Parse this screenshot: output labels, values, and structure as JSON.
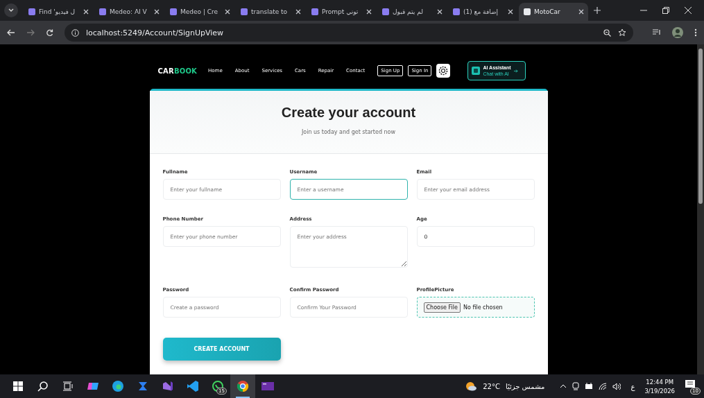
{
  "browser": {
    "tabs": [
      {
        "title": "Find 'ل فيديو",
        "selected": false
      },
      {
        "title": "Medeo: AI V",
        "selected": false
      },
      {
        "title": "Medeo | Cre",
        "selected": false
      },
      {
        "title": "translate to",
        "selected": false
      },
      {
        "title": "Prompt توني",
        "selected": false
      },
      {
        "title": "لم يتم قبول",
        "selected": false
      },
      {
        "title": "(1) إضافة مع",
        "selected": false
      },
      {
        "title": "MotoCar",
        "selected": true
      }
    ],
    "address": "localhost:5249/Account/SignUpView"
  },
  "nav": {
    "logo": [
      "CAR",
      "BOOK"
    ],
    "links": [
      "Home",
      "About",
      "Services",
      "Cars",
      "Repair",
      "Contact"
    ],
    "buttons": [
      "Sign Up",
      "Sign In"
    ],
    "assistant": {
      "title": "AI Assistant",
      "subtitle": "Chat with AI"
    }
  },
  "form": {
    "title": "Create your account",
    "subtitle": "Join us today and get started now",
    "fields": [
      {
        "label": "Fullname",
        "kind": "input",
        "placeholder": "Enter your fullname",
        "focused": false
      },
      {
        "label": "Username",
        "kind": "input",
        "placeholder": "Enter a username",
        "focused": true
      },
      {
        "label": "Email",
        "kind": "input",
        "placeholder": "Enter your email address",
        "focused": false
      },
      {
        "label": "Phone Number",
        "kind": "input",
        "placeholder": "Enter your phone number",
        "focused": false
      },
      {
        "label": "Address",
        "kind": "textarea",
        "placeholder": "Enter your address",
        "focused": false
      },
      {
        "label": "Age",
        "kind": "input",
        "value": "0",
        "focused": false
      },
      {
        "label": "Password",
        "kind": "input",
        "placeholder": "Create a password",
        "focused": false
      },
      {
        "label": "Confirm Password",
        "kind": "input",
        "placeholder": "Confirm Your Password",
        "focused": false
      },
      {
        "label": "ProfilePicture",
        "kind": "file",
        "button": "Choose File",
        "status": "No file chosen",
        "focused": false
      }
    ],
    "submit": "CREATE ACCOUNT"
  },
  "taskbar": {
    "apps": [
      {
        "kind": "copilot",
        "selected": false
      },
      {
        "kind": "edge",
        "selected": false
      },
      {
        "kind": "app",
        "selected": false
      },
      {
        "kind": "vs",
        "selected": false
      },
      {
        "kind": "vscode",
        "selected": false
      },
      {
        "kind": "whatsapp",
        "badge": "15",
        "selected": false
      },
      {
        "kind": "chrome",
        "selected": true
      },
      {
        "kind": "terminal",
        "selected": false
      }
    ],
    "weather": {
      "temperature": "22°C",
      "condition": "مشمس جزئيًا"
    },
    "language": "ع",
    "time": "12:44 PM",
    "date": "3/19/2026",
    "notifications": "10"
  }
}
